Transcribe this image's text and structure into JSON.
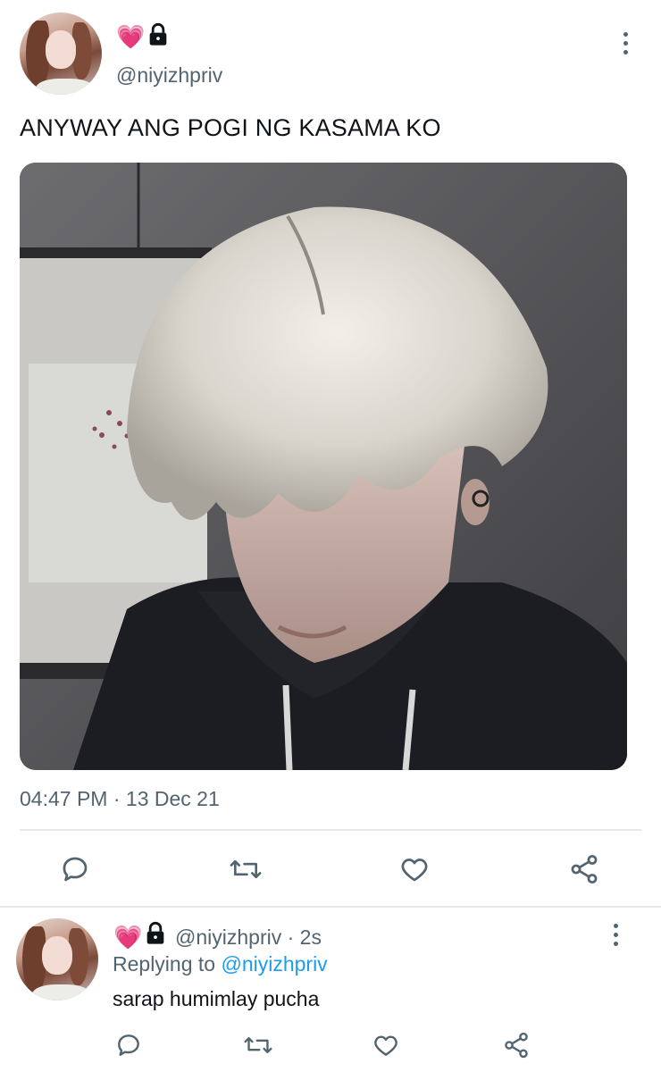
{
  "tweet": {
    "handle": "@niyizhpriv",
    "badge_heart": "💗",
    "text": "ANYWAY ANG POGI NG KASAMA KO",
    "time": "04:47 PM",
    "separator": "·",
    "date": "13 Dec 21",
    "icons": {
      "more": "more-vertical-icon",
      "reply": "reply-icon",
      "retweet": "retweet-icon",
      "like": "heart-icon",
      "share": "share-icon",
      "lock": "lock-icon"
    }
  },
  "reply": {
    "badge_heart": "💗",
    "handle": "@niyizhpriv",
    "separator": "·",
    "age": "2s",
    "replying_prefix": "Replying to",
    "replying_to": "@niyizhpriv",
    "text": "sarap humimlay pucha"
  },
  "colors": {
    "accent": "#1d9bf0",
    "muted": "#536471",
    "heart": "#ff4fb0"
  }
}
